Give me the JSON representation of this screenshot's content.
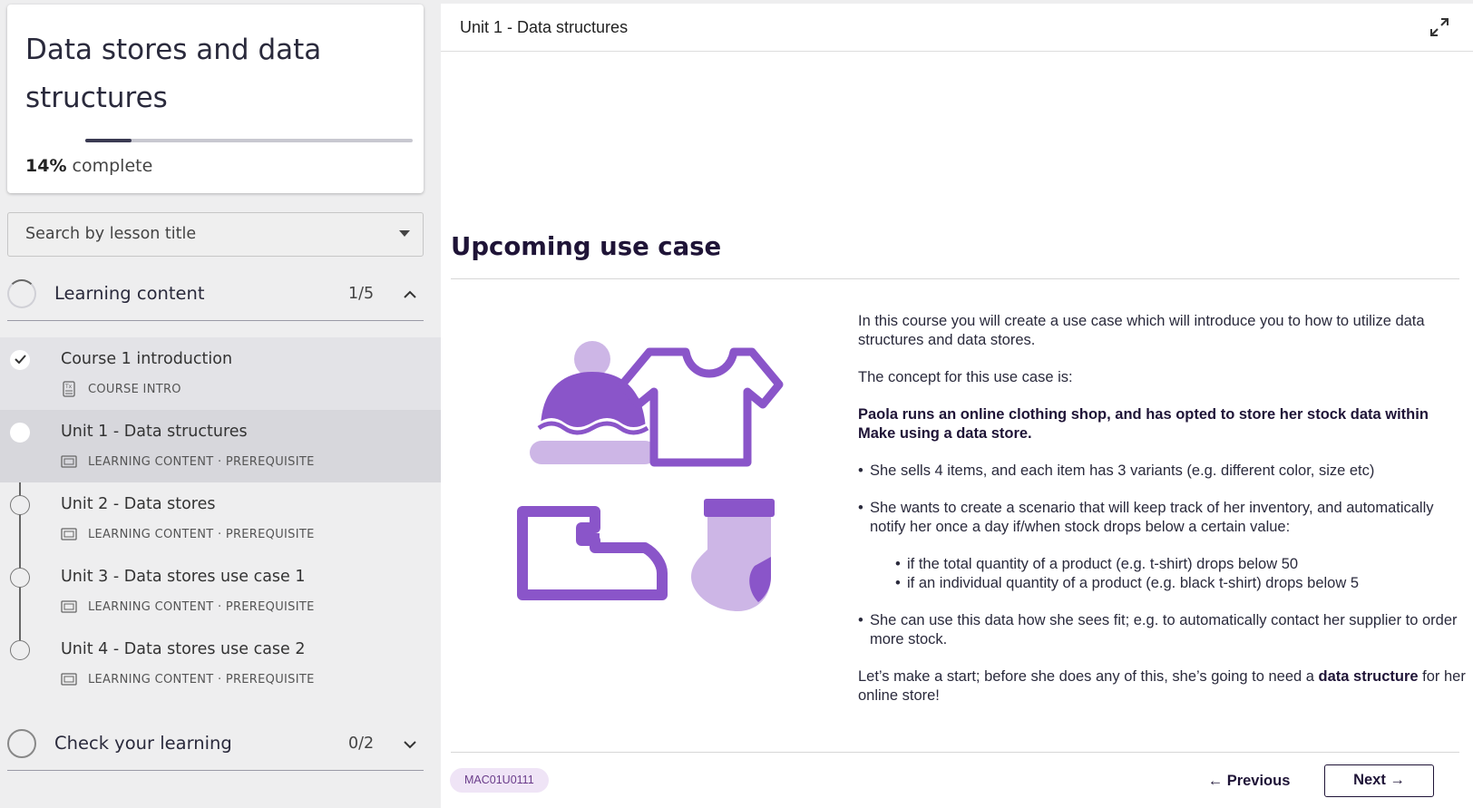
{
  "sidebar": {
    "course_title": "Data stores and data structures",
    "progress_percent": "14%",
    "progress_suffix": "complete",
    "progress_value": 0.14,
    "search_placeholder": "Search by lesson title",
    "sections": [
      {
        "label": "Learning content",
        "count": "1/5",
        "expanded": true,
        "lessons": [
          {
            "title": "Course 1 introduction",
            "meta": "COURSE INTRO",
            "state": "done"
          },
          {
            "title": "Unit 1 - Data structures",
            "meta": "LEARNING CONTENT · PREREQUISITE",
            "state": "active"
          },
          {
            "title": "Unit 2 - Data stores",
            "meta": "LEARNING CONTENT · PREREQUISITE",
            "state": "todo"
          },
          {
            "title": "Unit 3 - Data stores use case 1",
            "meta": "LEARNING CONTENT · PREREQUISITE",
            "state": "todo"
          },
          {
            "title": "Unit 4 - Data stores use case 2",
            "meta": "LEARNING CONTENT · PREREQUISITE",
            "state": "todo"
          }
        ]
      },
      {
        "label": "Check your learning",
        "count": "0/2",
        "expanded": false
      }
    ]
  },
  "main": {
    "unit_title": "Unit 1 - Data structures",
    "heading": "Upcoming use case",
    "intro": "In this course you will create a use case which will introduce you to how to utilize data structures and data stores.",
    "concept_lead": "The concept for this use case is:",
    "concept": "Paola runs an online clothing shop, and has opted to store her stock data within Make using a data store.",
    "bullet1": "She sells 4 items, and each item has 3 variants (e.g. different color, size etc)",
    "bullet2": "She wants to create a scenario that will keep track of her inventory, and automatically notify her once a day if/when stock drops below a certain value:",
    "sub_bullet1": "if the total quantity of a product (e.g. t-shirt) drops below 50",
    "sub_bullet2": "if an individual quantity of a product (e.g. black t-shirt) drops below 5",
    "bullet3": "She can use this data how she sees fit; e.g. to automatically contact her supplier to order more stock.",
    "closing_start": "Let’s make a start; before she does any of this, she’s going to need a ",
    "closing_bold": "data structure",
    "closing_end": " for her online store!",
    "lesson_code": "MAC01U0111",
    "prev_label": "Previous",
    "next_label": "Next"
  },
  "colors": {
    "accent_purple": "#8a55c9",
    "light_purple": "#cdb6e6",
    "heading_dark": "#1f1437"
  },
  "icons": [
    "expand-icon",
    "chevron-up-icon",
    "chevron-down-icon",
    "caret-down-icon",
    "check-icon",
    "course-intro-doc-icon",
    "learning-content-icon",
    "arrow-left-icon",
    "arrow-right-icon"
  ]
}
